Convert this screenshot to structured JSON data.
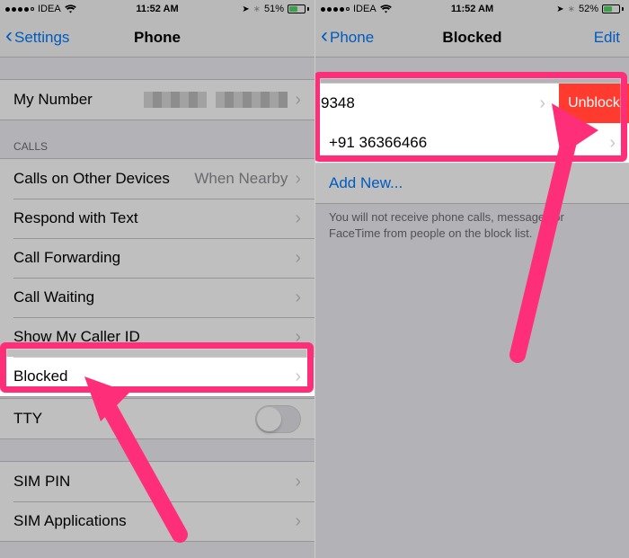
{
  "left": {
    "status": {
      "carrier": "IDEA",
      "time": "11:52 AM",
      "battery_pct": "51%",
      "battery_fill": 51
    },
    "nav": {
      "back": "Settings",
      "title": "Phone"
    },
    "my_number_label": "My Number",
    "calls_header": "CALLS",
    "rows": {
      "calls_other": "Calls on Other Devices",
      "calls_other_detail": "When Nearby",
      "respond": "Respond with Text",
      "forwarding": "Call Forwarding",
      "waiting": "Call Waiting",
      "caller_id": "Show My Caller ID",
      "blocked": "Blocked",
      "tty": "TTY",
      "sim_pin": "SIM PIN",
      "sim_apps": "SIM Applications"
    }
  },
  "right": {
    "status": {
      "carrier": "IDEA",
      "time": "11:52 AM",
      "battery_pct": "52%",
      "battery_fill": 52
    },
    "nav": {
      "back": "Phone",
      "title": "Blocked",
      "edit": "Edit"
    },
    "blocked_numbers": {
      "row1": "9348",
      "row2": "+91 36366466"
    },
    "unblock_label": "Unblock",
    "add_new": "Add New...",
    "footer": "You will not receive phone calls, messages or FaceTime from people on the block list."
  }
}
